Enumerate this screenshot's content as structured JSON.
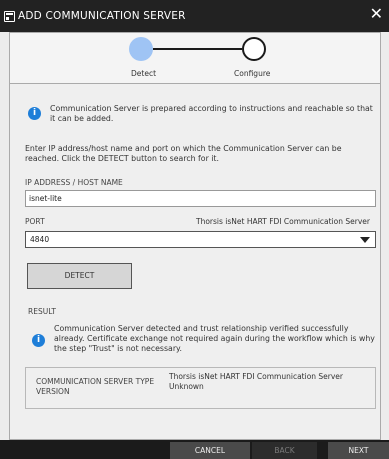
{
  "window": {
    "title": "ADD COMMUNICATION SERVER"
  },
  "steps": [
    {
      "label": "Detect",
      "state": "active"
    },
    {
      "label": "Configure",
      "state": "pending"
    }
  ],
  "info_message": "Communication Server is prepared according to instructions and reachable so that it can be added.",
  "intro_text": "Enter IP address/host name and port on which the Communication Server can be reached. Click the DETECT button to search for it.",
  "ip": {
    "label": "IP ADDRESS / HOST NAME",
    "value": "isnet-lite"
  },
  "port": {
    "label": "PORT",
    "value": "4840",
    "server_name": "Thorsis isNet HART FDI Communication Server"
  },
  "detect_label": "DETECT",
  "result": {
    "label": "RESULT",
    "message": "Communication Server detected and trust relationship verified successfully already. Certificate exchange not required again during the workflow which is why the step \"Trust\" is not necessary.",
    "type_key": "COMMUNICATION SERVER TYPE VERSION",
    "type_value": "Thorsis isNet HART FDI Communication Server",
    "version_value": "Unknown"
  },
  "footer": {
    "cancel": "CANCEL",
    "back": "BACK",
    "next": "NEXT"
  },
  "colors": {
    "accent": "#1e7ed8",
    "active_step": "#9fc4f4",
    "titlebar": "#222222"
  },
  "icons": {
    "app": "app-icon",
    "close": "close-icon",
    "info": "info-icon",
    "dropdown": "chevron-down-icon"
  }
}
